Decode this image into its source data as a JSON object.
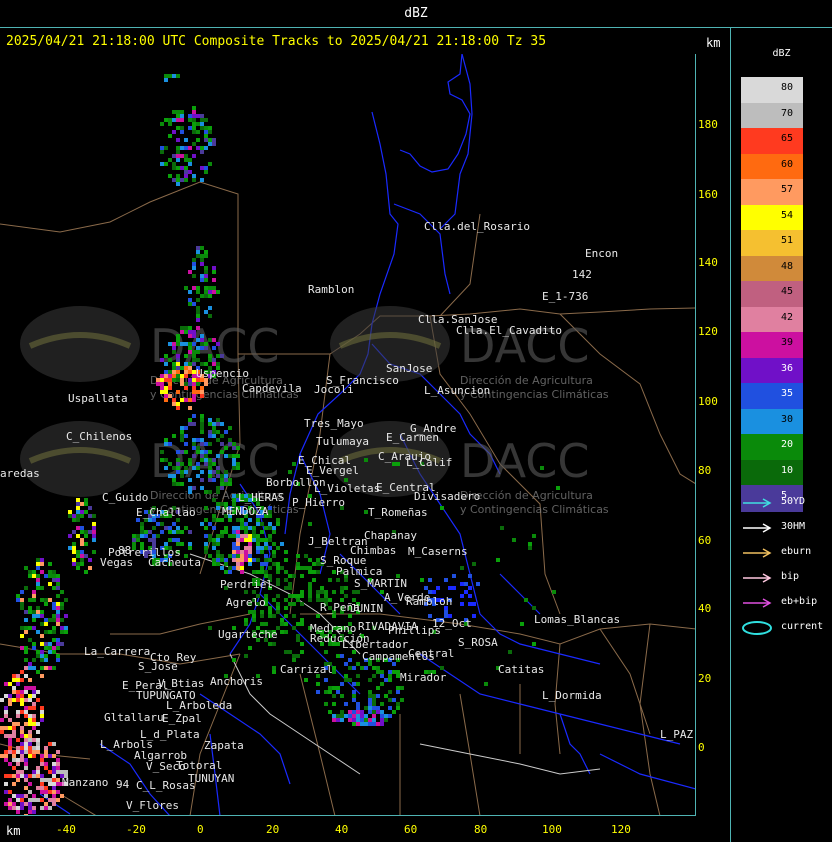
{
  "window": {
    "title": "dBZ"
  },
  "header": {
    "text": "2025/04/21 21:18:00 UTC Composite Tracks to 2025/04/21 21:18:00 Tz 35",
    "km_top": "km",
    "km_bottom": "km"
  },
  "axes": {
    "y_ticks": [
      "180",
      "160",
      "140",
      "120",
      "100",
      "80",
      "60",
      "40",
      "20",
      "0"
    ],
    "x_ticks": [
      "-40",
      "-20",
      "0",
      "20",
      "40",
      "60",
      "80",
      "100",
      "120"
    ]
  },
  "watermark": {
    "brand": "DACC",
    "line1": "Dirección de Agricultura",
    "line2": "y Contingencias Climáticas"
  },
  "places": [
    {
      "name": "Clla.del_Rosario"
    },
    {
      "name": "Encon"
    },
    {
      "name": "Ramblon"
    },
    {
      "name": "E_1-736"
    },
    {
      "name": "142"
    },
    {
      "name": "Clla.SanJose"
    },
    {
      "name": "Clla.El_Cavadito"
    },
    {
      "name": "Uspallata"
    },
    {
      "name": "Uspencio"
    },
    {
      "name": "Capdevila"
    },
    {
      "name": "S_Francisco"
    },
    {
      "name": "Jocoli"
    },
    {
      "name": "SanJose"
    },
    {
      "name": "L_Asuncion"
    },
    {
      "name": "C_Chilenos"
    },
    {
      "name": "Tres_Mayo"
    },
    {
      "name": "Tulumaya"
    },
    {
      "name": "G_Andre"
    },
    {
      "name": "E_Carmen"
    },
    {
      "name": "aredas"
    },
    {
      "name": "E_Chical"
    },
    {
      "name": "E_Vergel"
    },
    {
      "name": "C_Araujo"
    },
    {
      "name": "L_Calif"
    },
    {
      "name": "Borbollon"
    },
    {
      "name": "L_Violetas"
    },
    {
      "name": "E_Central"
    },
    {
      "name": "C_Guido"
    },
    {
      "name": "L_HERAS"
    },
    {
      "name": "P_Hierro"
    },
    {
      "name": "Divisadero"
    },
    {
      "name": "E_Challao"
    },
    {
      "name": "MENDOZA"
    },
    {
      "name": "T_Romeñas"
    },
    {
      "name": "Chapanay"
    },
    {
      "name": "J_Beltran"
    },
    {
      "name": "Potrerillos"
    },
    {
      "name": "Chimbas"
    },
    {
      "name": "M_Caserns"
    },
    {
      "name": "Vegas"
    },
    {
      "name": "Cacheuta"
    },
    {
      "name": "S_Roque"
    },
    {
      "name": "Palmica"
    },
    {
      "name": "S_MARTIN"
    },
    {
      "name": "Perdriel"
    },
    {
      "name": "A_Verde"
    },
    {
      "name": "Rambloh"
    },
    {
      "name": "Agrelo"
    },
    {
      "name": "R_Peña"
    },
    {
      "name": "JUNIN"
    },
    {
      "name": "Lomas_Blancas"
    },
    {
      "name": "12_Oct"
    },
    {
      "name": "Ugarteche"
    },
    {
      "name": "Medrano"
    },
    {
      "name": "RIVADAVIA"
    },
    {
      "name": "Phillips"
    },
    {
      "name": "S_ROSA"
    },
    {
      "name": "Reducción"
    },
    {
      "name": "Libertador"
    },
    {
      "name": "La_Carrera"
    },
    {
      "name": "Cto_Rey"
    },
    {
      "name": "Campamentos"
    },
    {
      "name": "Central"
    },
    {
      "name": "Catitas"
    },
    {
      "name": "S_Jose"
    },
    {
      "name": "Carrizal"
    },
    {
      "name": "E_Peral"
    },
    {
      "name": "V_Btias"
    },
    {
      "name": "Anchoris"
    },
    {
      "name": "Mirador"
    },
    {
      "name": "TUPUNGATO"
    },
    {
      "name": "L_Dormida"
    },
    {
      "name": "L_Arboleda"
    },
    {
      "name": "Gltallaru"
    },
    {
      "name": "E_Zpal"
    },
    {
      "name": "L_d_Plata"
    },
    {
      "name": "L_Arbols"
    },
    {
      "name": "Zapata"
    },
    {
      "name": "L_PAZ"
    },
    {
      "name": "Algarrob"
    },
    {
      "name": "Totoral"
    },
    {
      "name": "V_Seco"
    },
    {
      "name": "TUNUYAN"
    },
    {
      "name": "Manzano"
    },
    {
      "name": "C_L_Rosas"
    },
    {
      "name": "V_Flores"
    },
    {
      "name": "88"
    },
    {
      "name": "94"
    }
  ],
  "legend": {
    "title": "dBZ",
    "scale": [
      {
        "value": "80",
        "color": "#d9d9d9"
      },
      {
        "value": "70",
        "color": "#bdbdbd"
      },
      {
        "value": "65",
        "color": "#ff3a1f"
      },
      {
        "value": "60",
        "color": "#ff6a10"
      },
      {
        "value": "57",
        "color": "#ff9a60"
      },
      {
        "value": "54",
        "color": "#ffff00"
      },
      {
        "value": "51",
        "color": "#f5c030"
      },
      {
        "value": "48",
        "color": "#d08a3a"
      },
      {
        "value": "45",
        "color": "#c06080"
      },
      {
        "value": "42",
        "color": "#e080a0"
      },
      {
        "value": "39",
        "color": "#cc10a0"
      },
      {
        "value": "36",
        "color": "#7010c8"
      },
      {
        "value": "35",
        "color": "#2050e0"
      },
      {
        "value": "30",
        "color": "#1a90e0"
      },
      {
        "value": "20",
        "color": "#0a8a0a"
      },
      {
        "value": "10",
        "color": "#0a6a0a"
      },
      {
        "value": "5",
        "color": "#4a3a9a"
      }
    ],
    "tracks": [
      {
        "label": "50YD",
        "color": "#40e0e0"
      },
      {
        "label": "30HM",
        "color": "#ffffff"
      },
      {
        "label": "eburn",
        "color": "#f0c060"
      },
      {
        "label": "bip",
        "color": "#ffc8e0"
      },
      {
        "label": "eb+bip",
        "color": "#e050e0"
      },
      {
        "label": "current",
        "color": "#30e0e0"
      }
    ]
  }
}
